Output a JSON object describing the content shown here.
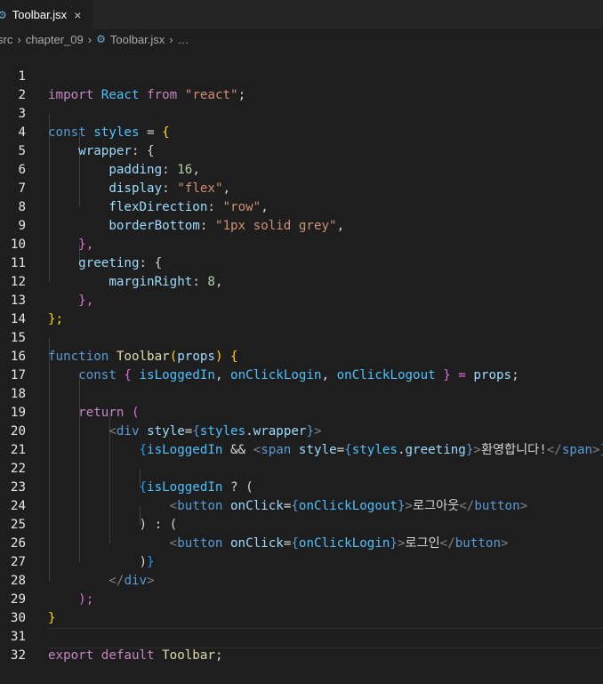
{
  "tab": {
    "filename": "Toolbar.jsx",
    "close_icon": "×"
  },
  "breadcrumb": {
    "folder1": "src",
    "folder2": "chapter_09",
    "file": "Toolbar.jsx",
    "more": "…"
  },
  "editor": {
    "line_numbers": [
      "1",
      "2",
      "3",
      "4",
      "5",
      "6",
      "7",
      "8",
      "9",
      "10",
      "11",
      "12",
      "13",
      "14",
      "15",
      "16",
      "17",
      "18",
      "19",
      "20",
      "21",
      "22",
      "23",
      "24",
      "25",
      "26",
      "27",
      "28",
      "29",
      "30",
      "31",
      "32"
    ],
    "code": {
      "l1": [
        "import",
        "React",
        "from",
        "\"react\"",
        ";"
      ],
      "l3": [
        "const",
        "styles",
        "=",
        "{"
      ],
      "l4": [
        "wrapper",
        ": {"
      ],
      "l5": [
        "padding",
        ": ",
        "16",
        ","
      ],
      "l6": [
        "display",
        ": ",
        "\"flex\"",
        ","
      ],
      "l7": [
        "flexDirection",
        ": ",
        "\"row\"",
        ","
      ],
      "l8": [
        "borderBottom",
        ": ",
        "\"1px solid grey\"",
        ","
      ],
      "l9": [
        "},"
      ],
      "l10": [
        "greeting",
        ": {"
      ],
      "l11": [
        "marginRight",
        ": ",
        "8",
        ","
      ],
      "l12": [
        "},"
      ],
      "l13": [
        "};"
      ],
      "l15": [
        "function",
        "Toolbar",
        "(",
        "props",
        ")",
        " {"
      ],
      "l16": [
        "const",
        " { ",
        "isLoggedIn",
        ", ",
        "onClickLogin",
        ", ",
        "onClickLogout",
        " } = ",
        "props",
        ";"
      ],
      "l18": [
        "return",
        " ("
      ],
      "l19": [
        "<",
        "div",
        "style",
        "=",
        "{",
        "styles",
        ".",
        "wrapper",
        "}",
        ">"
      ],
      "l20": [
        "{",
        "isLoggedIn",
        " && ",
        "<",
        "span",
        "style",
        "=",
        "{",
        "styles",
        ".",
        "greeting",
        "}",
        ">",
        "환영합니다!",
        "</",
        "span",
        ">",
        "}"
      ],
      "l22": [
        "{",
        "isLoggedIn",
        " ? ("
      ],
      "l23": [
        "<",
        "button",
        "onClick",
        "=",
        "{",
        "onClickLogout",
        "}",
        ">",
        "로그아웃",
        "</",
        "button",
        ">"
      ],
      "l24": [
        ") : ("
      ],
      "l25": [
        "<",
        "button",
        "onClick",
        "=",
        "{",
        "onClickLogin",
        "}",
        ">",
        "로그인",
        "</",
        "button",
        ">"
      ],
      "l26": [
        ")",
        "}"
      ],
      "l27": [
        "</",
        "div",
        ">"
      ],
      "l28": [
        ");"
      ],
      "l29": [
        "}"
      ],
      "l31": [
        "export",
        "default",
        "Toolbar",
        ";"
      ]
    }
  }
}
